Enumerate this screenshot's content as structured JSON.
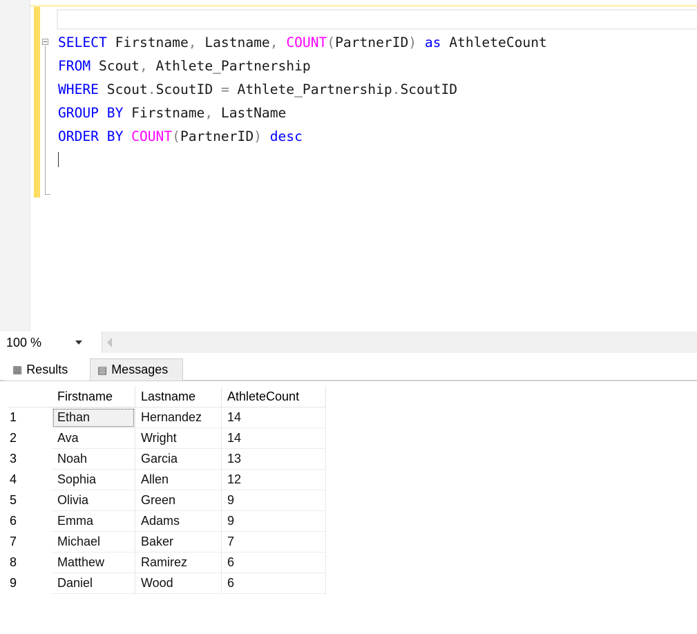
{
  "editor": {
    "code_lines": [
      [
        {
          "text": "SELECT",
          "cls": "kw"
        },
        {
          "text": " Firstname",
          "cls": "id"
        },
        {
          "text": ",",
          "cls": "op"
        },
        {
          "text": " Lastname",
          "cls": "id"
        },
        {
          "text": ",",
          "cls": "op"
        },
        {
          "text": " ",
          "cls": "id"
        },
        {
          "text": "COUNT",
          "cls": "fn"
        },
        {
          "text": "(",
          "cls": "op"
        },
        {
          "text": "PartnerID",
          "cls": "id"
        },
        {
          "text": ")",
          "cls": "op"
        },
        {
          "text": " ",
          "cls": "id"
        },
        {
          "text": "as",
          "cls": "kw"
        },
        {
          "text": " AthleteCount",
          "cls": "id"
        }
      ],
      [
        {
          "text": "FROM",
          "cls": "kw"
        },
        {
          "text": " Scout",
          "cls": "id"
        },
        {
          "text": ",",
          "cls": "op"
        },
        {
          "text": " Athlete_Partnership",
          "cls": "id"
        }
      ],
      [
        {
          "text": "WHERE",
          "cls": "kw"
        },
        {
          "text": " Scout",
          "cls": "id"
        },
        {
          "text": ".",
          "cls": "op"
        },
        {
          "text": "ScoutID ",
          "cls": "id"
        },
        {
          "text": "=",
          "cls": "op"
        },
        {
          "text": " Athlete_Partnership",
          "cls": "id"
        },
        {
          "text": ".",
          "cls": "op"
        },
        {
          "text": "ScoutID",
          "cls": "id"
        }
      ],
      [
        {
          "text": "GROUP BY",
          "cls": "kw"
        },
        {
          "text": " Firstname",
          "cls": "id"
        },
        {
          "text": ",",
          "cls": "op"
        },
        {
          "text": " LastName",
          "cls": "id"
        }
      ],
      [
        {
          "text": "ORDER BY",
          "cls": "kw"
        },
        {
          "text": " ",
          "cls": "id"
        },
        {
          "text": "COUNT",
          "cls": "fn"
        },
        {
          "text": "(",
          "cls": "op"
        },
        {
          "text": "PartnerID",
          "cls": "id"
        },
        {
          "text": ")",
          "cls": "op"
        },
        {
          "text": " ",
          "cls": "id"
        },
        {
          "text": "desc",
          "cls": "kw"
        }
      ]
    ]
  },
  "zoom": {
    "value": "100 %"
  },
  "tabs": {
    "results_label": "Results",
    "messages_label": "Messages"
  },
  "results": {
    "columns": [
      "Firstname",
      "Lastname",
      "AthleteCount"
    ],
    "rows": [
      {
        "num": "1",
        "cells": [
          "Ethan",
          "Hernandez",
          "14"
        ]
      },
      {
        "num": "2",
        "cells": [
          "Ava",
          "Wright",
          "14"
        ]
      },
      {
        "num": "3",
        "cells": [
          "Noah",
          "Garcia",
          "13"
        ]
      },
      {
        "num": "4",
        "cells": [
          "Sophia",
          "Allen",
          "12"
        ]
      },
      {
        "num": "5",
        "cells": [
          "Olivia",
          "Green",
          "9"
        ]
      },
      {
        "num": "6",
        "cells": [
          "Emma",
          "Adams",
          "9"
        ]
      },
      {
        "num": "7",
        "cells": [
          "Michael",
          "Baker",
          "7"
        ]
      },
      {
        "num": "8",
        "cells": [
          "Matthew",
          "Ramirez",
          "6"
        ]
      },
      {
        "num": "9",
        "cells": [
          "Daniel",
          "Wood",
          "6"
        ]
      }
    ]
  }
}
